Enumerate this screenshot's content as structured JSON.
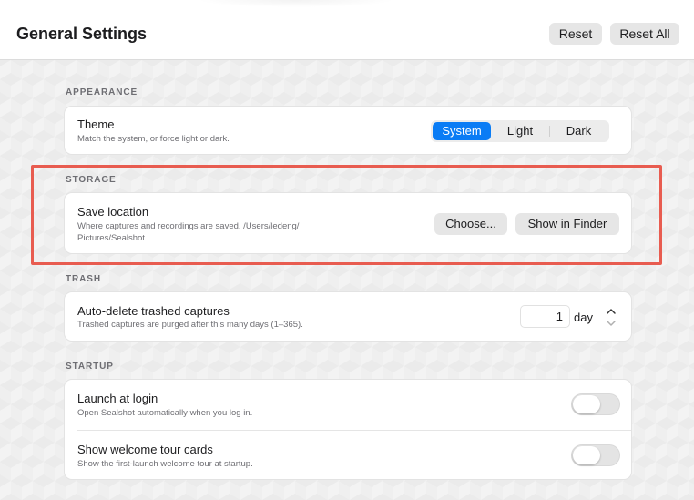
{
  "header": {
    "title": "General Settings",
    "reset_label": "Reset",
    "reset_all_label": "Reset All"
  },
  "sections": {
    "appearance": {
      "label": "APPEARANCE",
      "theme": {
        "title": "Theme",
        "subtitle": "Match the system, or force light or dark.",
        "options": [
          "System",
          "Light",
          "Dark"
        ],
        "selected": "System"
      }
    },
    "storage": {
      "label": "STORAGE",
      "save_location": {
        "title": "Save location",
        "subtitle_line1": "Where captures and recordings are saved. /Users/ledeng/",
        "subtitle_line2": "Pictures/Sealshot",
        "choose_label": "Choose...",
        "show_in_finder_label": "Show in Finder"
      }
    },
    "trash": {
      "label": "TRASH",
      "auto_delete": {
        "title": "Auto-delete trashed captures",
        "subtitle": "Trashed captures are purged after this many days (1–365).",
        "value": "1",
        "unit": "day"
      }
    },
    "startup": {
      "label": "STARTUP",
      "launch_at_login": {
        "title": "Launch at login",
        "subtitle": "Open Sealshot automatically when you log in.",
        "enabled": false
      },
      "welcome_tour": {
        "title": "Show welcome tour cards",
        "subtitle": "Show the first-launch welcome tour at startup.",
        "enabled": false
      }
    }
  },
  "colors": {
    "accent": "#0a7cf5",
    "highlight_border": "#e85c50"
  }
}
